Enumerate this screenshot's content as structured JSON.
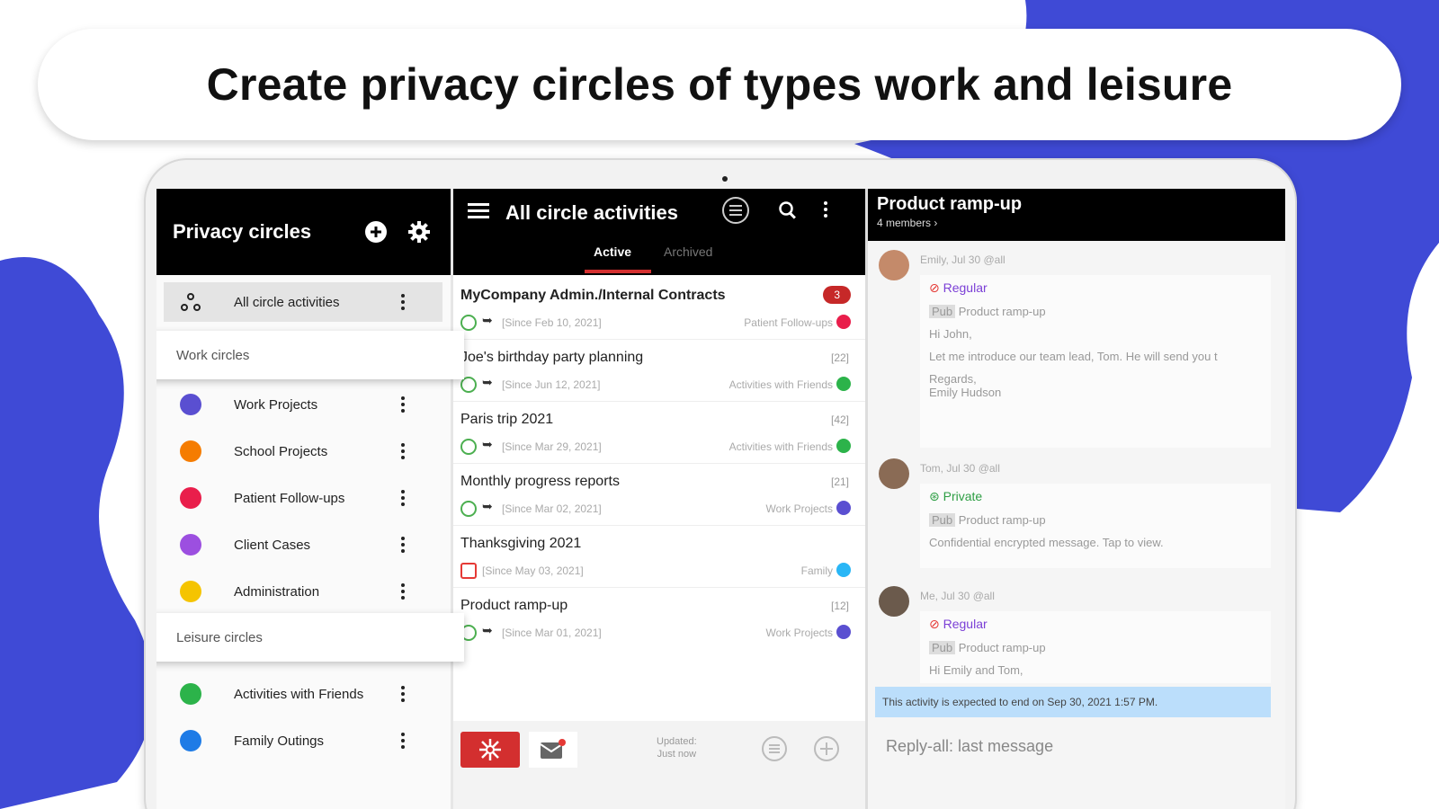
{
  "banner": {
    "title": "Create privacy circles of types work and leisure"
  },
  "colors": {
    "blob": "#3f4ad6",
    "header": "#000000",
    "accent_red": "#d32f2f"
  },
  "left_panel": {
    "title": "Privacy circles",
    "header_icons": [
      "add-circle-icon",
      "gear-icon"
    ],
    "all_item": {
      "label": "All circle activities",
      "icon": "circles-group-icon"
    },
    "work_section": {
      "label": "Work circles"
    },
    "work_items": [
      {
        "label": "Work Projects",
        "color": "#5a4fd1"
      },
      {
        "label": "School Projects",
        "color": "#f57c00"
      },
      {
        "label": "Patient Follow-ups",
        "color": "#e91e4b"
      },
      {
        "label": "Client Cases",
        "color": "#9c4fe0"
      },
      {
        "label": "Administration",
        "color": "#f5c400"
      }
    ],
    "leisure_section": {
      "label": "Leisure circles"
    },
    "leisure_items": [
      {
        "label": "Activities with Friends",
        "color": "#2cb34a"
      },
      {
        "label": "Family Outings",
        "color": "#1e7be6"
      }
    ]
  },
  "middle_panel": {
    "title": "All circle activities",
    "tabs": [
      {
        "label": "Active"
      },
      {
        "label": "Archived"
      }
    ],
    "activities": [
      {
        "name": "MyCompany Admin./Internal Contracts",
        "badge": "3",
        "since": "[Since Feb 10, 2021]",
        "circle": "Patient Follow-ups",
        "color": "#e91e4b"
      },
      {
        "name": "Joe's birthday party planning",
        "count": "[22]",
        "since": "[Since Jun 12, 2021]",
        "circle": "Activities with Friends",
        "color": "#2cb34a"
      },
      {
        "name": "Paris trip 2021",
        "count": "[42]",
        "since": "[Since Mar 29, 2021]",
        "circle": "Activities with Friends",
        "color": "#2cb34a"
      },
      {
        "name": "Monthly progress reports",
        "count": "[21]",
        "since": "[Since Mar 02, 2021]",
        "circle": "Work Projects",
        "color": "#5a4fd1"
      },
      {
        "name": "Thanksgiving 2021",
        "count": "",
        "since": "[Since May 03, 2021]",
        "circle": "Family",
        "color": "#29b6f6"
      },
      {
        "name": "Product ramp-up",
        "count": "[12]",
        "since": "[Since Mar 01, 2021]",
        "circle": "Work Projects",
        "color": "#5a4fd1"
      }
    ],
    "footer": {
      "updated_label": "Updated:",
      "updated_value": "Just now"
    }
  },
  "right_panel": {
    "title": "Product ramp-up",
    "subtitle": "4 members ›",
    "messages": [
      {
        "meta": "Emily, Jul 30   @all",
        "tag": "Regular",
        "tag_color": "#7b3fd6",
        "subject": "Product ramp-up",
        "lines": [
          "Hi John,",
          "Let me introduce our team lead, Tom. He will send you t",
          "Regards,\nEmily Hudson"
        ]
      },
      {
        "meta": "Tom, Jul 30   @all",
        "tag": "Private",
        "tag_color": "#2e9e44",
        "subject": "Product ramp-up",
        "lines": [
          "Confidential encrypted message. Tap to view."
        ]
      },
      {
        "meta": "Me, Jul 30   @all",
        "tag": "Regular",
        "tag_color": "#7b3fd6",
        "subject": "Product ramp-up",
        "lines": [
          "Hi Emily and Tom,"
        ]
      }
    ],
    "info_banner": "This activity is expected to end on Sep 30, 2021 1:57 PM.",
    "reply_placeholder": "Reply-all: last message",
    "pill_label": "Pub"
  }
}
